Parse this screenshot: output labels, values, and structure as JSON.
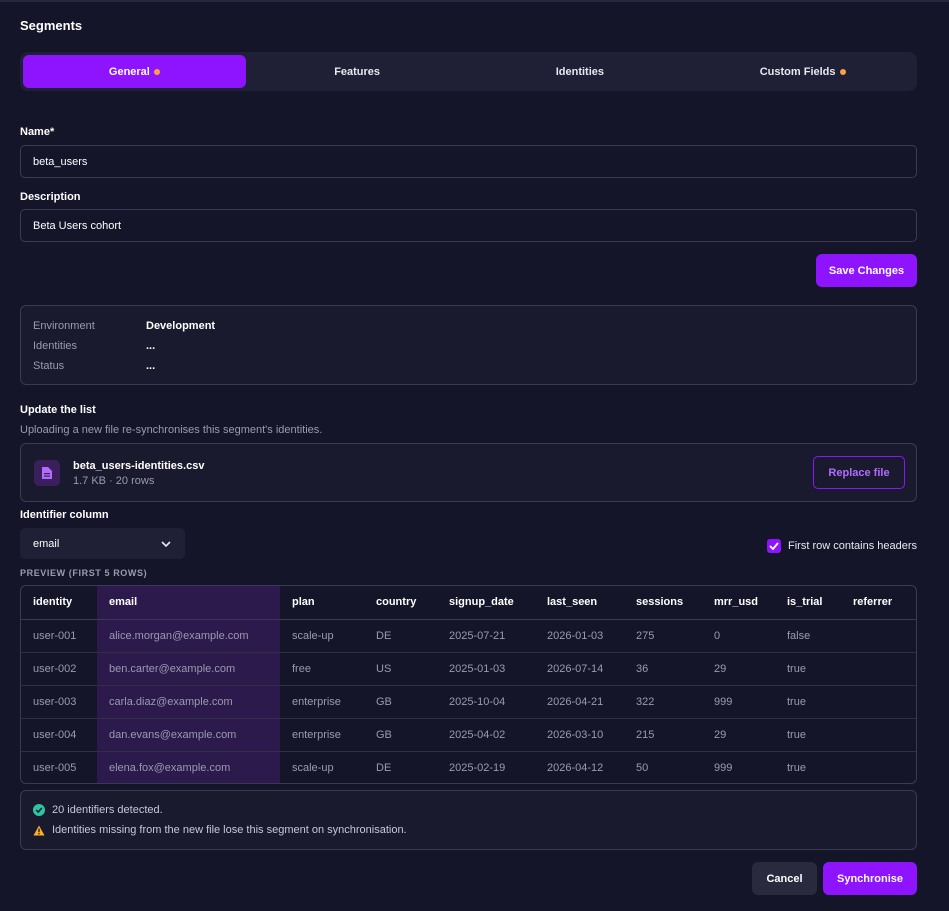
{
  "page": {
    "title": "Segments"
  },
  "tabs": [
    {
      "label": "General",
      "active": true,
      "has_dot": true
    },
    {
      "label": "Features",
      "active": false,
      "has_dot": false
    },
    {
      "label": "Identities",
      "active": false,
      "has_dot": false
    },
    {
      "label": "Custom Fields",
      "active": false,
      "has_dot": true
    }
  ],
  "form": {
    "name_label": "Name*",
    "name_value": "beta_users",
    "description_label": "Description",
    "description_value": "Beta Users cohort",
    "save_label": "Save Changes"
  },
  "info": {
    "environment_label": "Environment",
    "environment_value": "Development",
    "identities_label": "Identities",
    "identities_value": "...",
    "status_label": "Status",
    "status_value": "..."
  },
  "update": {
    "title": "Update the list",
    "subtitle": "Uploading a new file re-synchronises this segment's identities.",
    "file_name": "beta_users-identities.csv",
    "file_meta": "1.7 KB · 20 rows",
    "replace_label": "Replace file"
  },
  "identifier": {
    "label": "Identifier column",
    "selected": "email",
    "headers_checkbox_label": "First row contains headers",
    "headers_checked": true
  },
  "preview": {
    "label": "PREVIEW (FIRST 5 ROWS)",
    "columns": [
      "identity",
      "email",
      "plan",
      "country",
      "signup_date",
      "last_seen",
      "sessions",
      "mrr_usd",
      "is_trial",
      "referrer"
    ],
    "rows": [
      [
        "user-001",
        "alice.morgan@example.com",
        "scale-up",
        "DE",
        "2025-07-21",
        "2026-01-03",
        "275",
        "0",
        "false",
        ""
      ],
      [
        "user-002",
        "ben.carter@example.com",
        "free",
        "US",
        "2025-01-03",
        "2026-07-14",
        "36",
        "29",
        "true",
        ""
      ],
      [
        "user-003",
        "carla.diaz@example.com",
        "enterprise",
        "GB",
        "2025-10-04",
        "2026-04-21",
        "322",
        "999",
        "true",
        ""
      ],
      [
        "user-004",
        "dan.evans@example.com",
        "enterprise",
        "GB",
        "2025-04-02",
        "2026-03-10",
        "215",
        "29",
        "true",
        ""
      ],
      [
        "user-005",
        "elena.fox@example.com",
        "scale-up",
        "DE",
        "2025-02-19",
        "2026-04-12",
        "50",
        "999",
        "true",
        ""
      ]
    ]
  },
  "messages": {
    "success": "20 identifiers detected.",
    "warning": "Identities missing from the new file lose this segment on synchronisation."
  },
  "actions": {
    "cancel_label": "Cancel",
    "sync_label": "Synchronise"
  },
  "colors": {
    "accent": "#8e14ff",
    "dot": "#ff9f43",
    "success": "#2ec4a0",
    "warning": "#ffb020"
  }
}
